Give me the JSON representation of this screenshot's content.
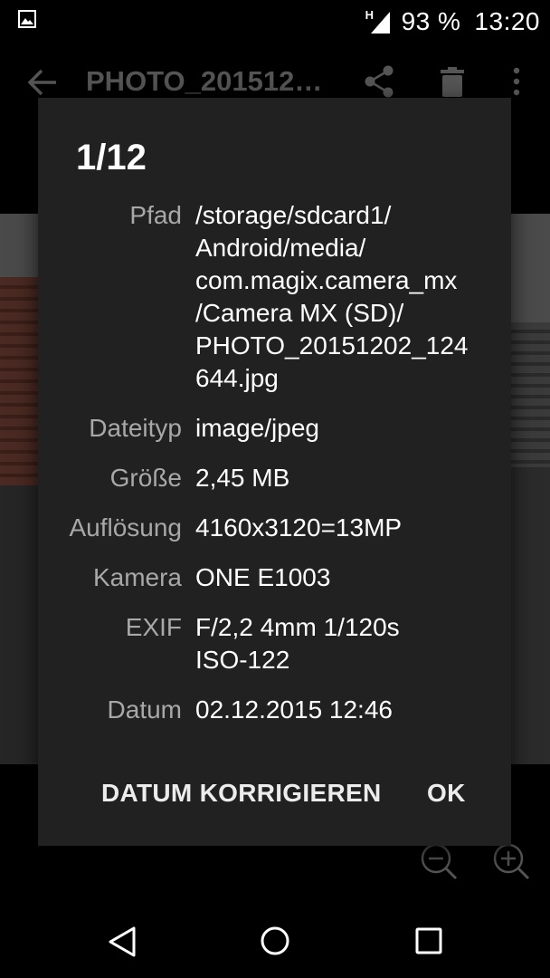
{
  "status_bar": {
    "signal_type": "H",
    "battery": "93 %",
    "time": "13:20"
  },
  "app_bar": {
    "title": "PHOTO_201512…",
    "icons": [
      "back-arrow-icon",
      "share-icon",
      "delete-icon",
      "more-icon"
    ]
  },
  "dialog": {
    "title": "1/12",
    "rows": [
      {
        "label": "Pfad",
        "lines": [
          "/storage/sdcard1/",
          "Android/media/",
          "com.magix.camera_mx",
          "/Camera MX (SD)/",
          "PHOTO_20151202_124",
          "644.jpg"
        ]
      },
      {
        "label": "Dateityp",
        "lines": [
          "image/jpeg"
        ]
      },
      {
        "label": "Größe",
        "lines": [
          "2,45 MB"
        ]
      },
      {
        "label": "Auflösung",
        "lines": [
          "4160x3120=13MP"
        ]
      },
      {
        "label": "Kamera",
        "lines": [
          "ONE E1003"
        ]
      },
      {
        "label": "EXIF",
        "lines": [
          "F/2,2 4mm 1/120s",
          "ISO-122"
        ]
      },
      {
        "label": "Datum",
        "lines": [
          "02.12.2015 12:46"
        ]
      }
    ],
    "buttons": {
      "fix_date": "DATUM KORRIGIEREN",
      "ok": "OK"
    }
  },
  "colors": {
    "dialog_bg": "#212121",
    "label": "#a8a8a8",
    "value": "#ffffff",
    "button": "#ececec"
  }
}
